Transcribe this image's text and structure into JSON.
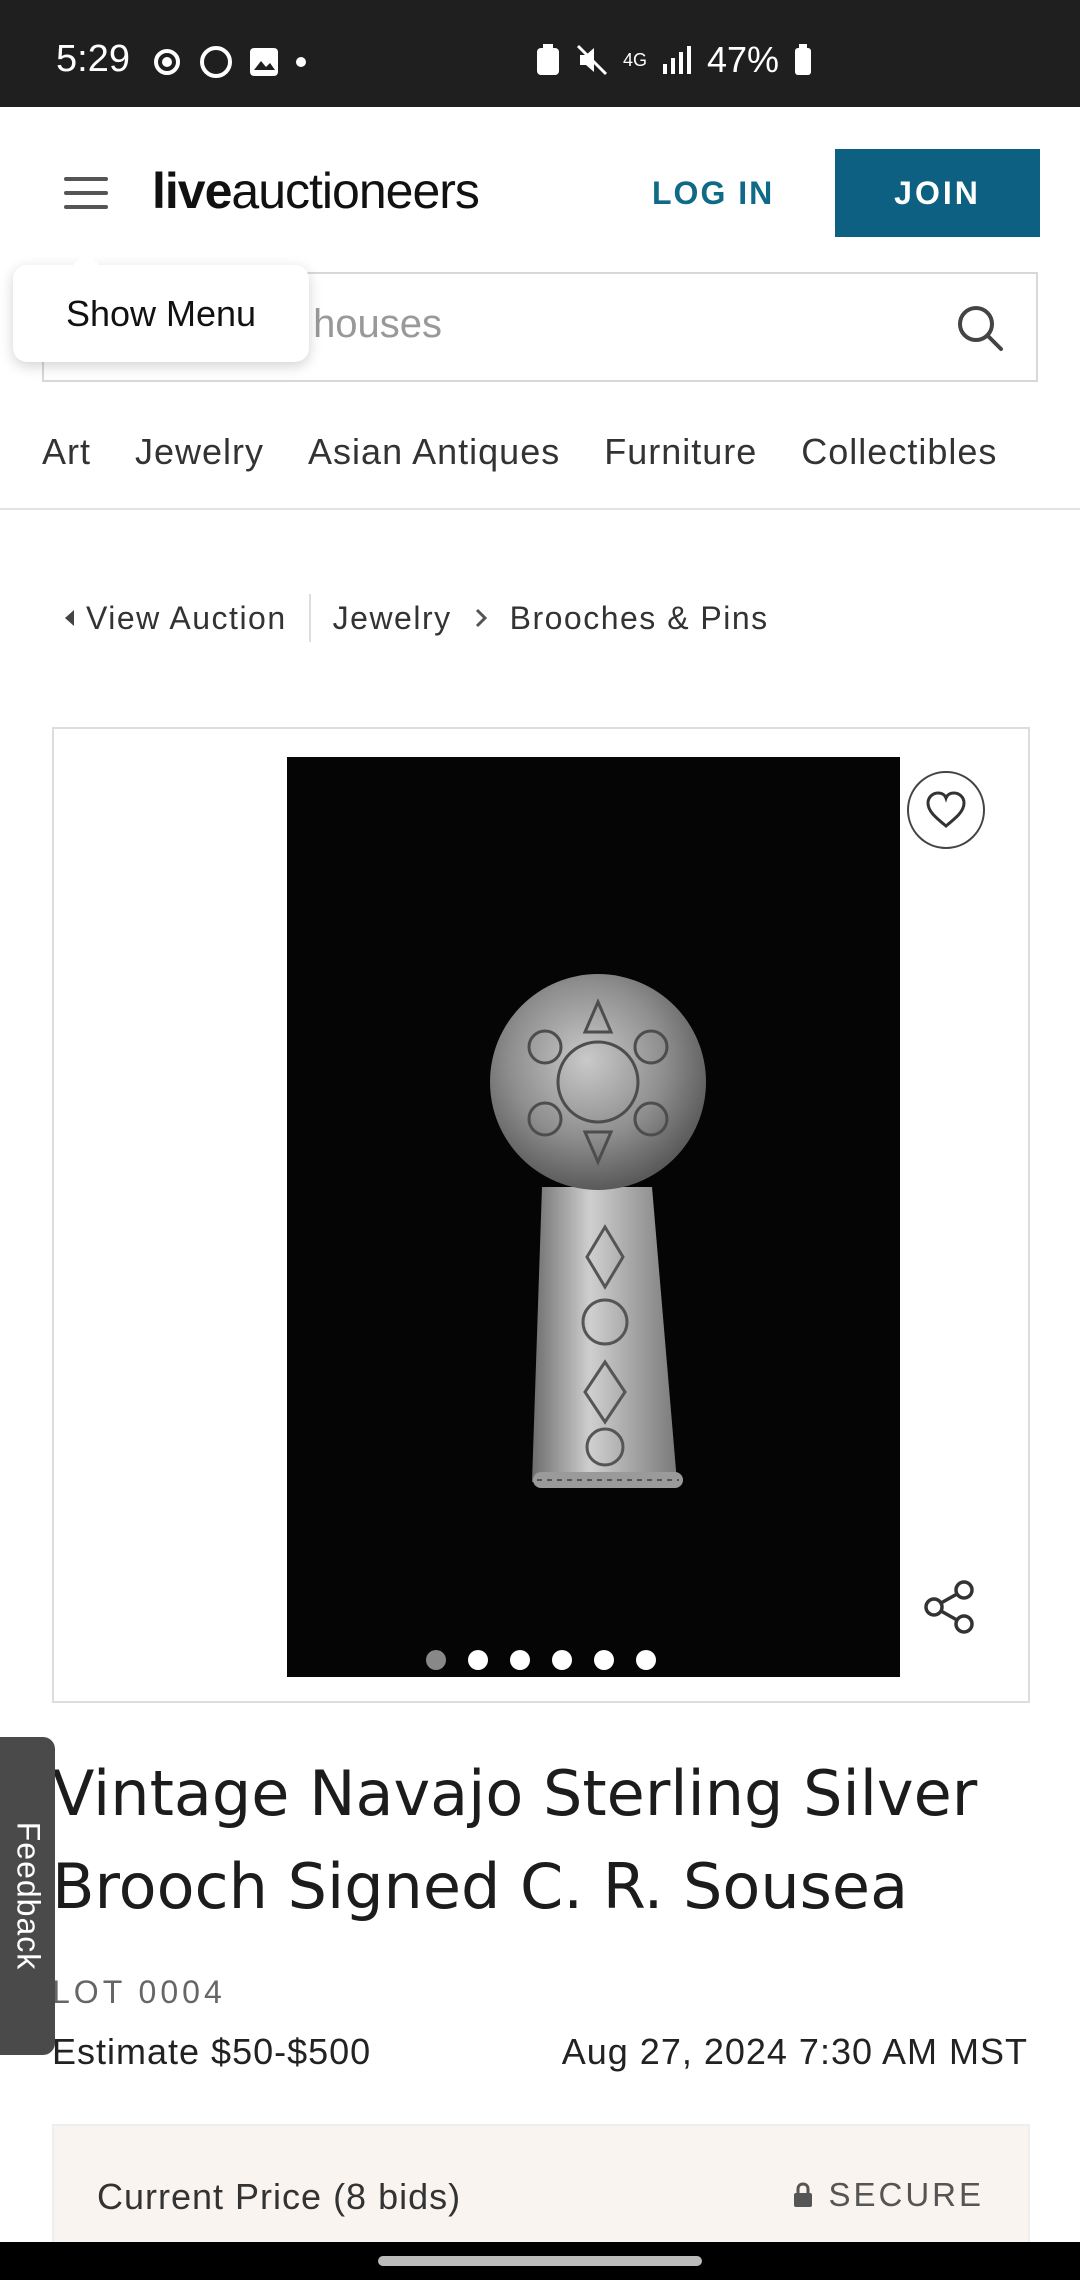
{
  "status_bar": {
    "time": "5:29",
    "battery": "47%",
    "network": "4G",
    "icons": [
      "sync-icon",
      "circle-icon",
      "image-icon",
      "dot-icon",
      "battery-saver-icon",
      "mute-icon",
      "signal-icon",
      "battery-icon"
    ]
  },
  "header": {
    "logo_bold": "live",
    "logo_rest": "auctioneers",
    "login_label": "LOG IN",
    "join_label": "JOIN",
    "brand_color": "#0d6082"
  },
  "search": {
    "placeholder_visible": "s and auction houses"
  },
  "tooltip": {
    "text": "Show Menu"
  },
  "categories": [
    "Art",
    "Jewelry",
    "Asian Antiques",
    "Furniture",
    "Collectibles"
  ],
  "breadcrumb": {
    "back_label": "View Auction",
    "crumb1": "Jewelry",
    "crumb2": "Brooches & Pins"
  },
  "gallery": {
    "image_count": 6,
    "active_index": 0
  },
  "feedback_label": "Feedback",
  "item": {
    "title": "Vintage Navajo Sterling Silver Brooch Signed C. R. Sousea",
    "lot": "LOT 0004",
    "estimate": "Estimate $50-$500",
    "date": "Aug 27, 2024 7:30 AM MST"
  },
  "price": {
    "label": "Current Price (8 bids)",
    "secure_label": "SECURE"
  }
}
